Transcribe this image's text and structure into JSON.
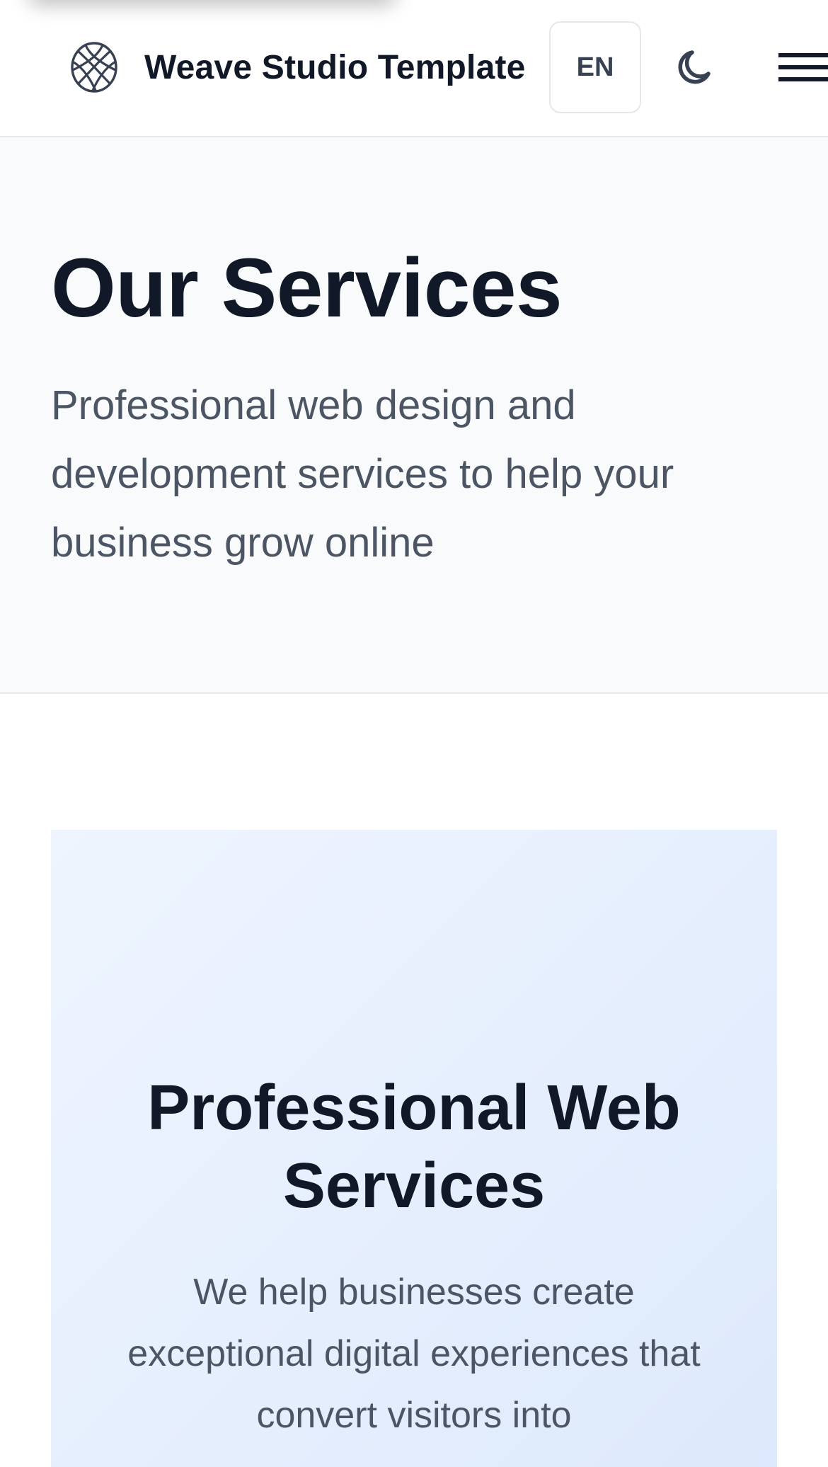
{
  "header": {
    "brand_name": "Weave Studio Template",
    "logo_icon": "woven-globe-logo-icon",
    "language_label": "EN",
    "theme_icon": "moon-icon",
    "menu_icon": "hamburger-menu-icon"
  },
  "hero": {
    "title": "Our Services",
    "subtitle": "Professional web design and development services to help your business grow online"
  },
  "card": {
    "title": "Professional Web Services",
    "text": "We help businesses create exceptional digital experiences that convert visitors into"
  },
  "colors": {
    "heading": "#111827",
    "body_text": "#4b5563",
    "hero_background": "#f8fafc",
    "card_background": "#e8f0fd",
    "border": "#e5e7eb",
    "icon": "#374151"
  }
}
